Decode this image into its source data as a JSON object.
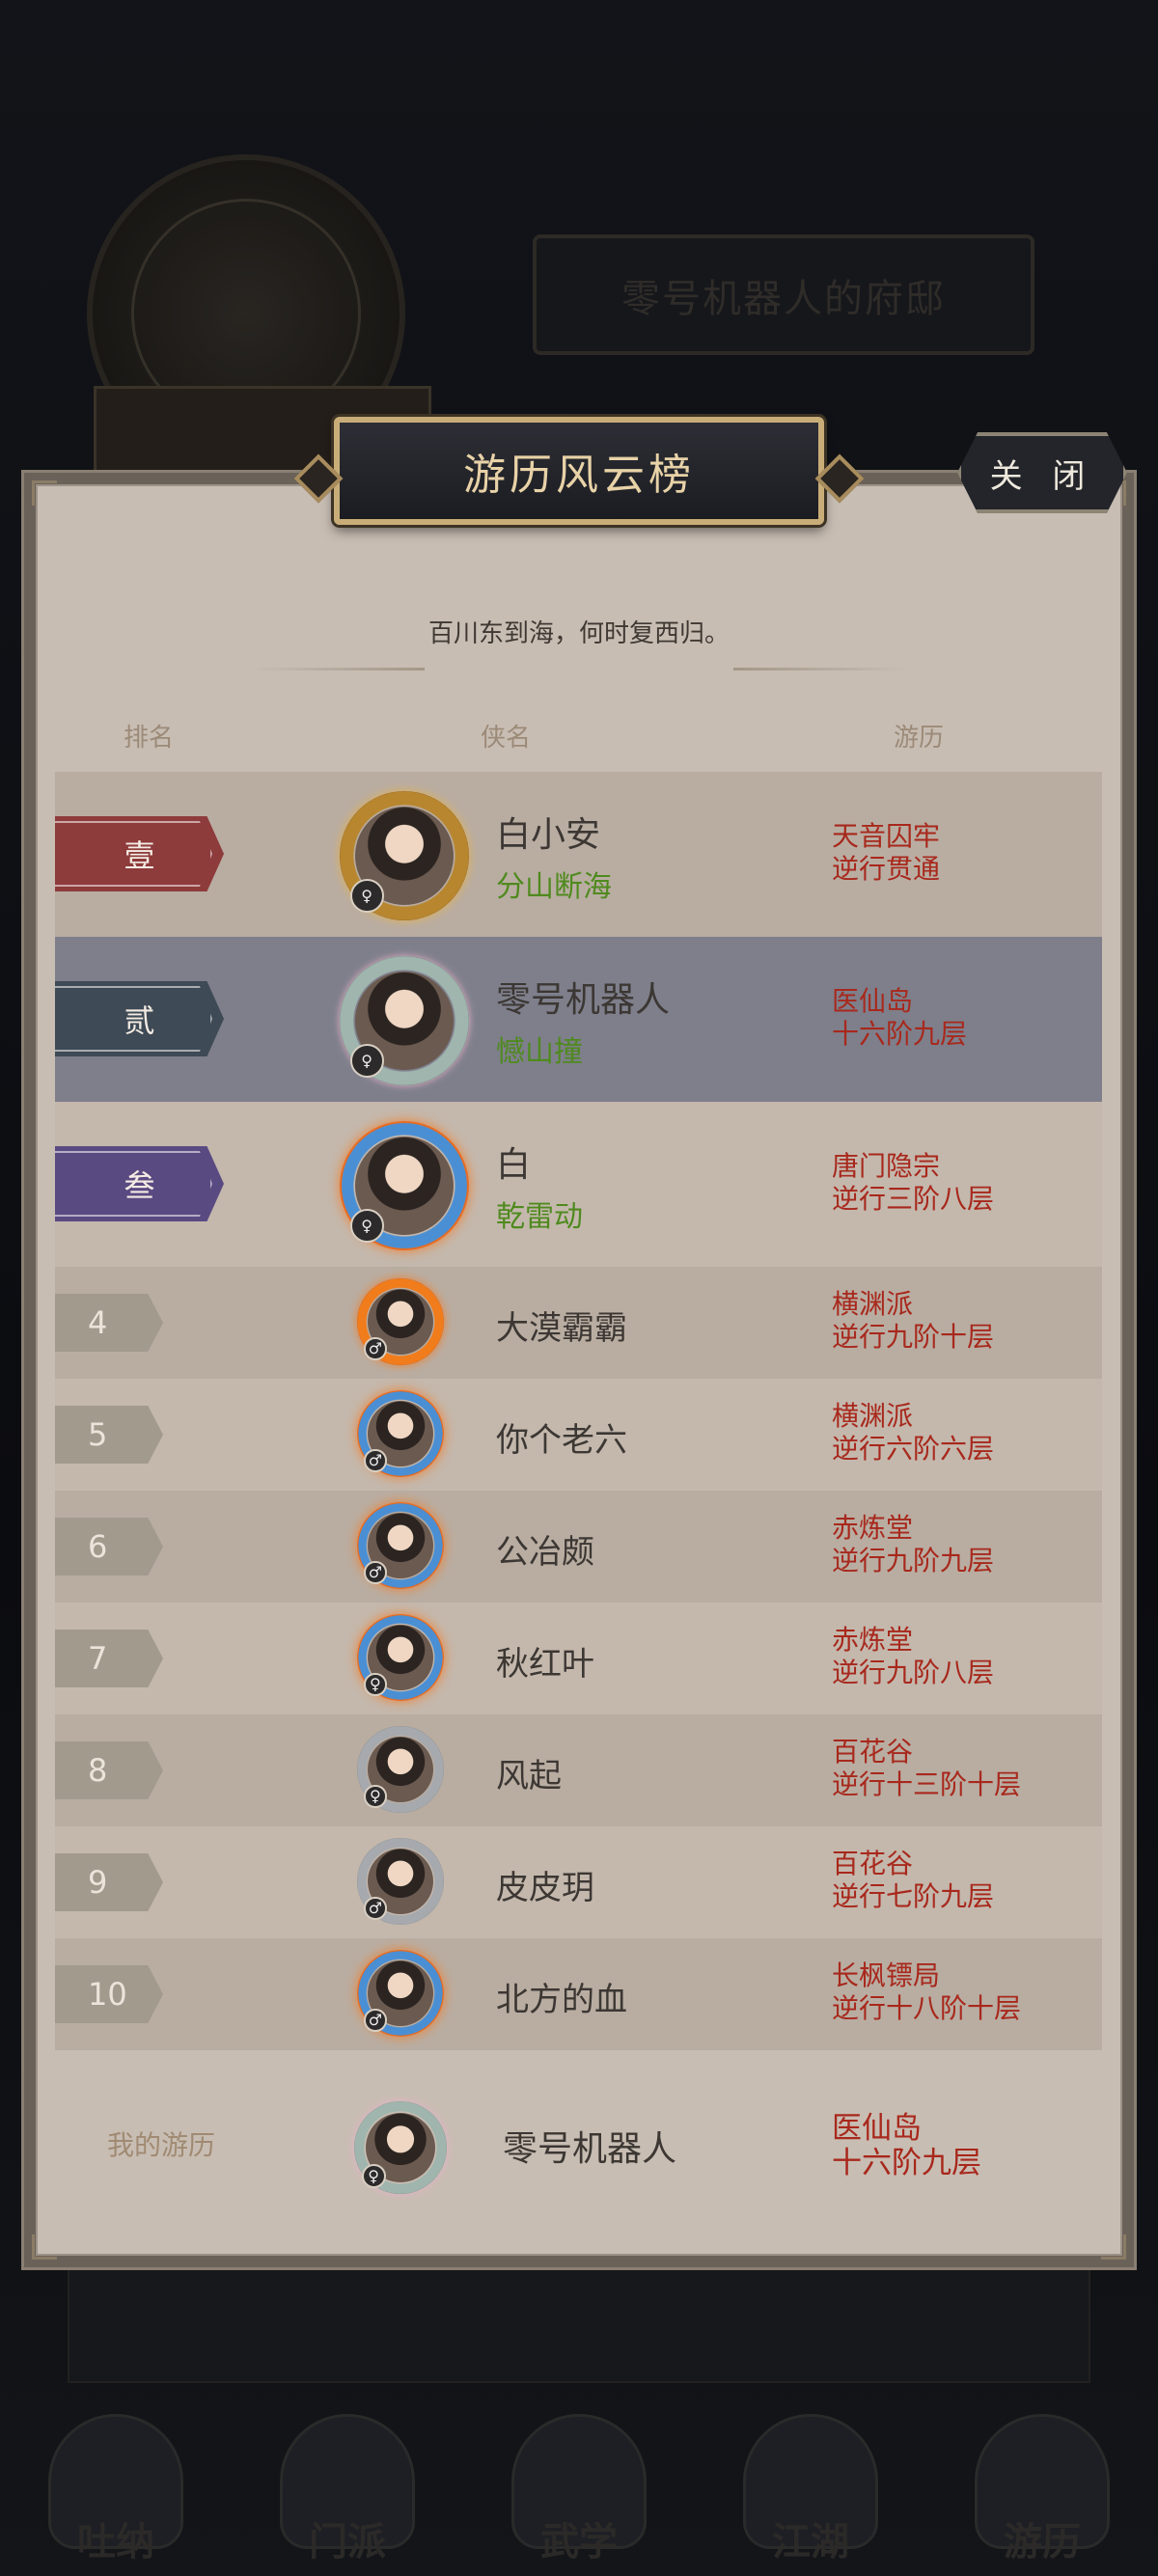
{
  "background": {
    "mansion_name": "零号机器人的府邸",
    "nav": [
      "吐纳",
      "门派",
      "武学",
      "江湖",
      "游历"
    ]
  },
  "modal": {
    "title": "游历风云榜",
    "close_label": "关 闭",
    "subtitle": "百川东到海，何时复西归。",
    "headers": {
      "rank": "排名",
      "name": "侠名",
      "journey": "游历"
    }
  },
  "colors": {
    "rank1": "#8e3b3b",
    "rank2": "#3e4a55",
    "rank3": "#5a4a82",
    "journey_text": "#a8281c",
    "title_text": "#4f8a1e",
    "highlight_row": "#7e7f8b"
  },
  "rows": [
    {
      "rank": "壹",
      "name": "白小安",
      "title": "分山断海",
      "journey_line1": "天音囚牢",
      "journey_line2": "逆行贯通"
    },
    {
      "rank": "贰",
      "name": "零号机器人",
      "title": "憾山撞",
      "journey_line1": "医仙岛",
      "journey_line2": "十六阶九层"
    },
    {
      "rank": "叁",
      "name": "白",
      "title": "乾雷动",
      "journey_line1": "唐门隐宗",
      "journey_line2": "逆行三阶八层"
    },
    {
      "rank": "4",
      "name": "大漠霸霸",
      "journey_line1": "横渊派",
      "journey_line2": "逆行九阶十层"
    },
    {
      "rank": "5",
      "name": "你个老六",
      "journey_line1": "横渊派",
      "journey_line2": "逆行六阶六层"
    },
    {
      "rank": "6",
      "name": "公冶颇",
      "journey_line1": "赤炼堂",
      "journey_line2": "逆行九阶九层"
    },
    {
      "rank": "7",
      "name": "秋红叶",
      "journey_line1": "赤炼堂",
      "journey_line2": "逆行九阶八层"
    },
    {
      "rank": "8",
      "name": "风起",
      "journey_line1": "百花谷",
      "journey_line2": "逆行十三阶十层"
    },
    {
      "rank": "9",
      "name": "皮皮玥",
      "journey_line1": "百花谷",
      "journey_line2": "逆行七阶九层"
    },
    {
      "rank": "10",
      "name": "北方的血",
      "journey_line1": "长枫镖局",
      "journey_line2": "逆行十八阶十层"
    }
  ],
  "my_journey": {
    "label": "我的游历",
    "name": "零号机器人",
    "journey_line1": "医仙岛",
    "journey_line2": "十六阶九层"
  }
}
